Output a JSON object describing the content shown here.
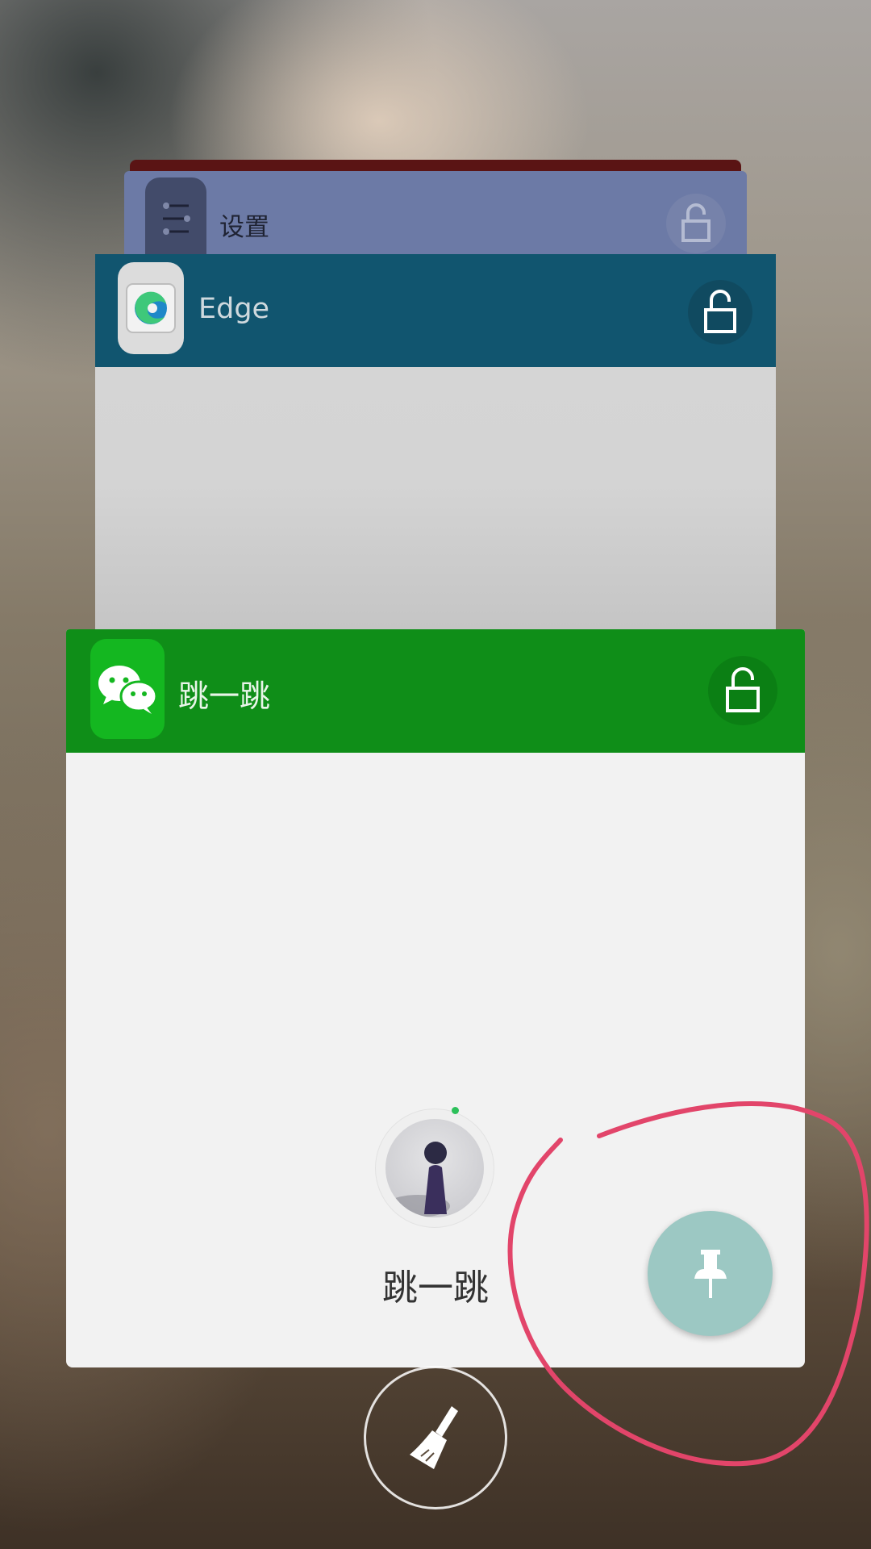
{
  "recent_apps": [
    {
      "id": "unknown",
      "label": ""
    },
    {
      "id": "settings",
      "label": "设置"
    },
    {
      "id": "edge",
      "label": "Edge"
    },
    {
      "id": "wechat",
      "label": "跳一跳"
    }
  ],
  "wechat_card": {
    "mini_program_title": "跳一跳"
  },
  "icons": {
    "lock": "lock-open-icon",
    "pin": "pin-icon",
    "clear": "broom-icon"
  },
  "colors": {
    "settings_header": "#6c7aa6",
    "edge_header": "#11556f",
    "wechat_header": "#0f8e18",
    "pin_fab": "#9cc8c3",
    "annotation": "#e2456a"
  }
}
